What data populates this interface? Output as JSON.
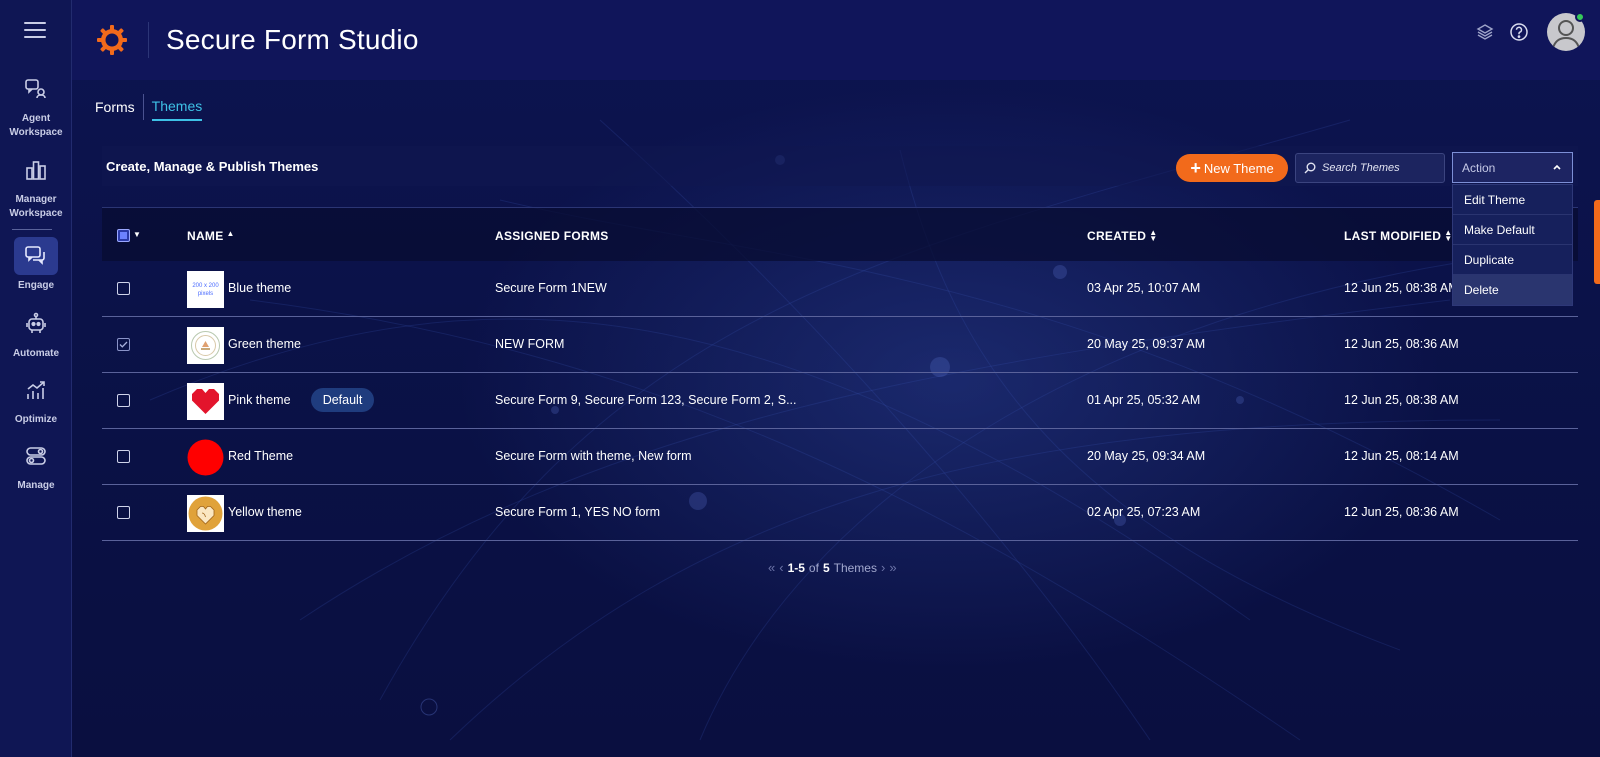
{
  "app": {
    "title": "Secure Form Studio"
  },
  "sidebar": {
    "items": [
      {
        "label": "Agent\nWorkspace",
        "icon": "agent-workspace-icon"
      },
      {
        "label": "Manager\nWorkspace",
        "icon": "bar-chart-icon"
      },
      {
        "label": "Engage",
        "icon": "chat-bubbles-icon",
        "active": true
      },
      {
        "label": "Automate",
        "icon": "robot-icon"
      },
      {
        "label": "Optimize",
        "icon": "trend-chart-icon"
      },
      {
        "label": "Manage",
        "icon": "toggles-icon"
      }
    ]
  },
  "tabs": [
    {
      "label": "Forms",
      "active": false
    },
    {
      "label": "Themes",
      "active": true
    }
  ],
  "toolbar": {
    "title": "Create, Manage & Publish Themes",
    "new_button": "New Theme",
    "search_placeholder": "Search Themes",
    "action_label": "Action"
  },
  "action_menu": {
    "items": [
      "Edit Theme",
      "Make Default",
      "Duplicate",
      "Delete"
    ],
    "highlighted": "Delete"
  },
  "table": {
    "headers": {
      "name": "NAME",
      "assigned": "ASSIGNED FORMS",
      "created": "CREATED",
      "modified": "LAST MODIFIED"
    },
    "rows": [
      {
        "name": "Blue theme",
        "thumb_text": "200 x 200\npixels",
        "assigned": "Secure Form 1NEW",
        "created": "03 Apr 25, 10:07 AM",
        "modified": "12 Jun 25, 08:38 AM",
        "checked": false
      },
      {
        "name": "Green theme",
        "assigned": "NEW FORM",
        "created": "20 May 25, 09:37 AM",
        "modified": "12 Jun 25, 08:36 AM",
        "checked": true
      },
      {
        "name": "Pink theme",
        "badge": "Default",
        "assigned": "Secure Form 9, Secure Form 123, Secure Form 2, S...",
        "created": "01 Apr 25, 05:32 AM",
        "modified": "12 Jun 25, 08:38 AM",
        "checked": false
      },
      {
        "name": "Red Theme",
        "assigned": "Secure Form with theme, New form",
        "created": "20 May 25, 09:34 AM",
        "modified": "12 Jun 25, 08:14 AM",
        "checked": false
      },
      {
        "name": "Yellow theme",
        "assigned": "Secure Form 1, YES NO form",
        "created": "02 Apr 25, 07:23 AM",
        "modified": "12 Jun 25, 08:36 AM",
        "checked": false
      }
    ]
  },
  "pagination": {
    "range": "1-5",
    "of": "of",
    "total": "5",
    "unit": "Themes"
  },
  "colors": {
    "accent_orange": "#f26a1b",
    "tab_active": "#3ec1e6",
    "sidebar_bg": "#0f1654",
    "header_bg": "#10155a"
  }
}
